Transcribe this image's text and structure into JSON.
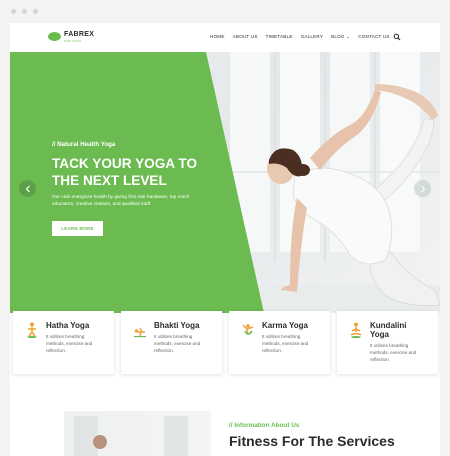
{
  "site": {
    "logo_name": "FABREX",
    "logo_tagline": "FOR YOGA"
  },
  "nav": {
    "items": [
      "HOME",
      "ABOUT US",
      "TIMETABLE",
      "GALLERY",
      "BLOG ⌄",
      "CONTACT US"
    ]
  },
  "hero": {
    "eyebrow": "// Natural Health Yoga",
    "headline_line1": "TACK YOUR YOGA TO",
    "headline_line2": "THE NEXT LEVEL",
    "lede_line1": "Our club energizes health by giving first rate hardware, top notch",
    "lede_line2": "educators, creative classes, and qualified staff.",
    "cta_label": "LEARN MORE",
    "prev_glyph": "‹",
    "next_glyph": "›"
  },
  "cards": [
    {
      "title": "Hatha Yoga",
      "text1": "It utilizes breathing",
      "text2": "methods, exercise and",
      "text3": "reflection."
    },
    {
      "title": "Bhakti Yoga",
      "text1": "It utilizes breathing",
      "text2": "methods, exercise and",
      "text3": "reflection."
    },
    {
      "title": "Karma Yoga",
      "text1": "It utilizes breathing",
      "text2": "methods, exercise and",
      "text3": "reflection."
    },
    {
      "title_line1": "Kundalini",
      "title_line2": "Yoga",
      "text1": "It utilizes breathing",
      "text2": "methods, exercise and",
      "text3": "reflection."
    }
  ],
  "about": {
    "eyebrow": "// Information About Us",
    "title": "Fitness For The Services"
  },
  "colors": {
    "brand_green": "#6cbb50",
    "text_dark": "#2b2b2b",
    "icon_orange": "#f0a23a"
  },
  "icons": {
    "search": "search-icon",
    "card": "yoga-pose-icon"
  }
}
